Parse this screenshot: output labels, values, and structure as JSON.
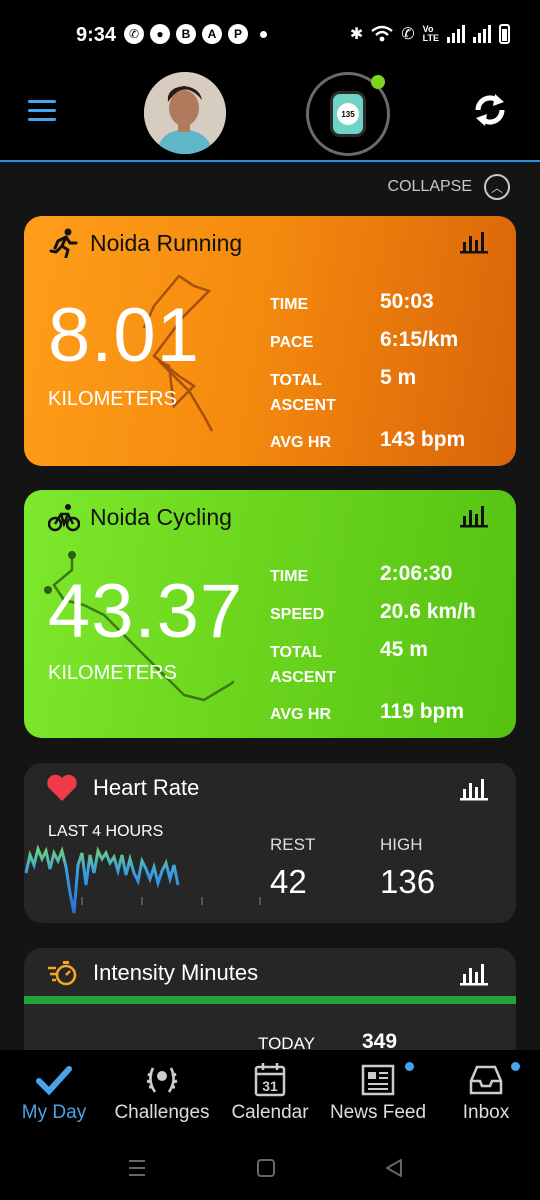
{
  "status": {
    "time": "9:34",
    "notification_icons": [
      "whatsapp-icon",
      "chat-icon",
      "b-icon",
      "a-icon",
      "pinterest-icon"
    ],
    "network_label": "Vo\nLTE"
  },
  "header": {
    "avatar": "profile-photo",
    "device": "watch",
    "device_face_value": "135",
    "device_status_color": "#7ed321"
  },
  "collapse_label": "COLLAPSE",
  "running": {
    "title": "Noida Running",
    "distance": "8.01",
    "unit": "KILOMETERS",
    "stats": [
      {
        "label": "TIME",
        "value": "50:03"
      },
      {
        "label": "PACE",
        "value": "6:15/km"
      },
      {
        "label": "TOTAL ASCENT",
        "value": "5 m"
      },
      {
        "label": "AVG HR",
        "value": "143 bpm"
      }
    ]
  },
  "cycling": {
    "title": "Noida Cycling",
    "distance": "43.37",
    "unit": "KILOMETERS",
    "stats": [
      {
        "label": "TIME",
        "value": "2:06:30"
      },
      {
        "label": "SPEED",
        "value": "20.6 km/h"
      },
      {
        "label": "TOTAL ASCENT",
        "value": "45 m"
      },
      {
        "label": "AVG HR",
        "value": "119 bpm"
      }
    ]
  },
  "heart_rate": {
    "title": "Heart Rate",
    "period": "LAST 4 HOURS",
    "rest_label": "REST",
    "rest_value": "42",
    "high_label": "HIGH",
    "high_value": "136"
  },
  "intensity": {
    "title": "Intensity Minutes",
    "today_label": "TODAY",
    "today_value": "349"
  },
  "nav": [
    {
      "label": "My Day",
      "active": true
    },
    {
      "label": "Challenges"
    },
    {
      "label": "Calendar",
      "calendar_day": "31"
    },
    {
      "label": "News Feed",
      "badge": true
    },
    {
      "label": "Inbox",
      "badge": true
    }
  ],
  "colors": {
    "accent": "#4aa3e8",
    "running": "#f58b0e",
    "cycling": "#6cd61e",
    "heart": "#ef3a48",
    "intensity_bar": "#1fa33a"
  }
}
